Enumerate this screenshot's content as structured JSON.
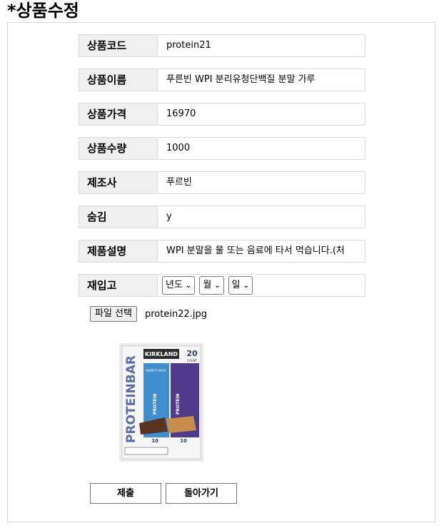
{
  "page": {
    "title": "*상품수정"
  },
  "form": {
    "rows": [
      {
        "label": "상품코드",
        "value": "protein21"
      },
      {
        "label": "상품이름",
        "value": "푸른빈 WPI 분리유청단백질 분말 가루"
      },
      {
        "label": "상품가격",
        "value": "16970"
      },
      {
        "label": "상품수량",
        "value": "1000"
      },
      {
        "label": "제조사",
        "value": "푸르빈"
      },
      {
        "label": "숨김",
        "value": "y"
      },
      {
        "label": "제품설명",
        "value": "WPI 분말을 물 또는 음료에 타서 먹습니다.(처"
      }
    ],
    "restock": {
      "label": "재입고",
      "year": "년도",
      "month": "월",
      "day": "일"
    },
    "file": {
      "button": "파일 선택",
      "name": "protein22.jpg"
    },
    "image": {
      "brand": "KIRKLAND",
      "count": "20",
      "count_label": "COUNT",
      "product": "PROTEINBAR",
      "variety": "VARIETY PACK",
      "left_flavor_count": "10",
      "right_flavor_count": "10",
      "bar_label_left": "PROTEIN",
      "bar_label_right": "PROTEIN"
    },
    "buttons": {
      "submit": "제출",
      "back": "돌아가기"
    }
  }
}
